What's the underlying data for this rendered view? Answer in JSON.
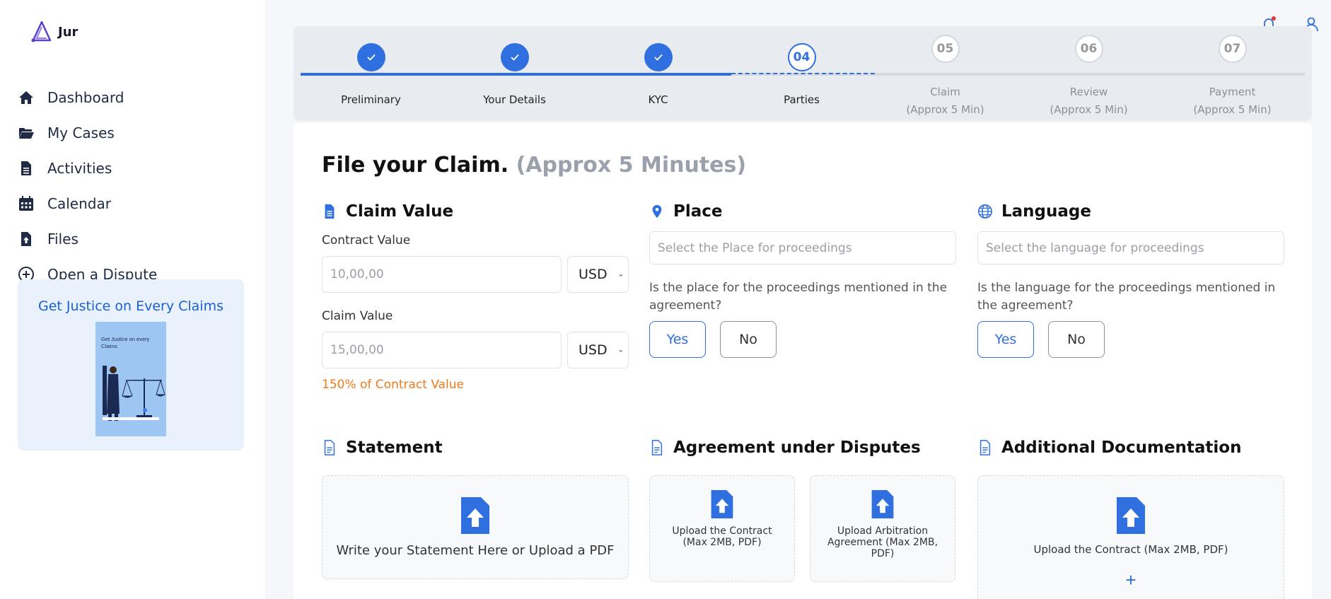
{
  "app": {
    "name": "Jur"
  },
  "sidebar": {
    "items": [
      {
        "label": "Dashboard",
        "icon": "home-icon"
      },
      {
        "label": "My Cases",
        "icon": "folder-open-icon"
      },
      {
        "label": "Activities",
        "icon": "document-icon"
      },
      {
        "label": "Calendar",
        "icon": "calendar-icon"
      },
      {
        "label": "Files",
        "icon": "file-upload-icon"
      },
      {
        "label": "Open a Dispute",
        "icon": "plus-circle-icon"
      }
    ],
    "promo": {
      "title": "Get Justice on Every Claims",
      "image_text": "Get Justice on every Claims"
    }
  },
  "stepper": {
    "steps": [
      {
        "number": "",
        "label": "Preliminary",
        "sub": "",
        "state": "done"
      },
      {
        "number": "",
        "label": "Your Details",
        "sub": "",
        "state": "done"
      },
      {
        "number": "",
        "label": "KYC",
        "sub": "",
        "state": "done"
      },
      {
        "number": "04",
        "label": "Parties",
        "sub": "",
        "state": "active"
      },
      {
        "number": "05",
        "label": "Claim",
        "sub": "(Approx 5 Min)",
        "state": "todo"
      },
      {
        "number": "06",
        "label": "Review",
        "sub": "(Approx 5 Min)",
        "state": "todo"
      },
      {
        "number": "07",
        "label": "Payment",
        "sub": "(Approx 5 Min)",
        "state": "todo"
      }
    ]
  },
  "page": {
    "title": "File your Claim.",
    "subtitle": "(Approx 5 Minutes)"
  },
  "claim_value": {
    "heading": "Claim Value",
    "contract_label": "Contract Value",
    "contract_placeholder": "10,00,00",
    "contract_currency": "USD",
    "claim_label": "Claim Value",
    "claim_placeholder": "15,00,00",
    "claim_currency": "USD",
    "hint": "150% of Contract Value"
  },
  "place": {
    "heading": "Place",
    "placeholder": "Select the Place for proceedings",
    "question": "Is the place for the proceedings mentioned in the agreement?",
    "yes": "Yes",
    "no": "No"
  },
  "language": {
    "heading": "Language",
    "placeholder": "Select the language for proceedings",
    "question": "Is the language for the proceedings mentioned in the agreement?",
    "yes": "Yes",
    "no": "No"
  },
  "statement": {
    "heading": "Statement",
    "drop_text": "Write your Statement Here or Upload a PDF"
  },
  "agreement": {
    "heading": "Agreement under Disputes",
    "drop1_text": "Upload the Contract (Max 2MB, PDF)",
    "drop2_text": "Upload Arbitration Agreement (Max 2MB, PDF)"
  },
  "additional": {
    "heading": "Additional Documentation",
    "drop_text": "Upload the Contract (Max 2MB, PDF)",
    "plus": "+"
  },
  "colors": {
    "accent": "#2f6fe0",
    "hint": "#f07a1c",
    "promo_bg": "#e9f1fd"
  }
}
